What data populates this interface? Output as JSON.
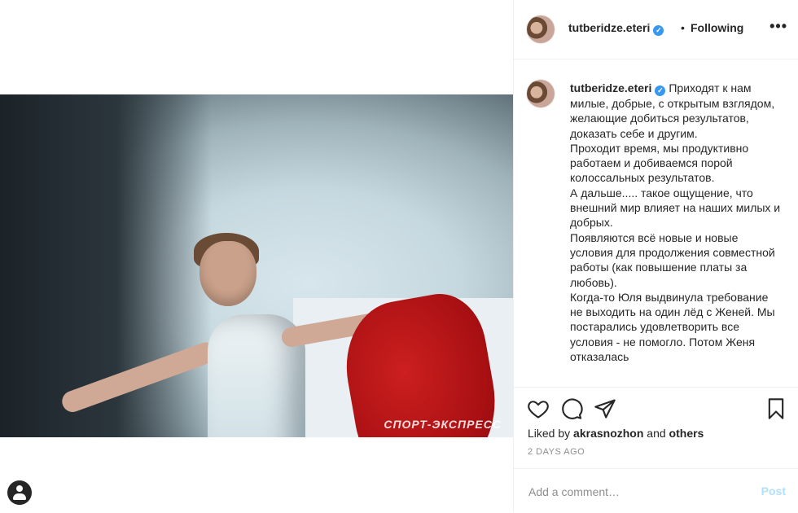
{
  "post": {
    "image_alt": "",
    "watermark": "СПОРТ-ЭКСПРЕСС"
  },
  "header": {
    "username": "tutberidze.eteri",
    "verified_mark": "✓",
    "separator": "•",
    "follow_label": "Following",
    "more_label": "•••"
  },
  "caption": {
    "username": "tutberidze.eteri",
    "verified_mark": "✓",
    "lines": [
      "Приходят к нам милые, добрые, с открытым взглядом, желающие добиться результатов, доказать себе и другим.",
      "Проходит время, мы продуктивно работаем и добиваемся порой колоссальных результатов.",
      "А дальше..... такое ощущение, что внешний мир влияет на наших милых и добрых.",
      "Появляются всё новые и новые условия для продолжения совместной работы (как повышение платы за любовь).",
      "Когда-то Юля выдвинула требование не выходить на один лёд с Женей. Мы постарались удовлетворить все условия - не помогло. Потом Женя отказалась"
    ]
  },
  "actions": {
    "like_icon": "heart-icon",
    "comment_icon": "comment-icon",
    "share_icon": "paper-plane-icon",
    "save_icon": "bookmark-icon"
  },
  "likes": {
    "prefix": "Liked by",
    "user": "akrasnozhon",
    "and": "and",
    "others": "others"
  },
  "time": "2 DAYS AGO",
  "comment_box": {
    "placeholder": "Add a comment…",
    "post_label": "Post"
  },
  "colors": {
    "verified": "#3897f0",
    "post_disabled": "#b2dffc",
    "muted": "#8e8e8e"
  }
}
